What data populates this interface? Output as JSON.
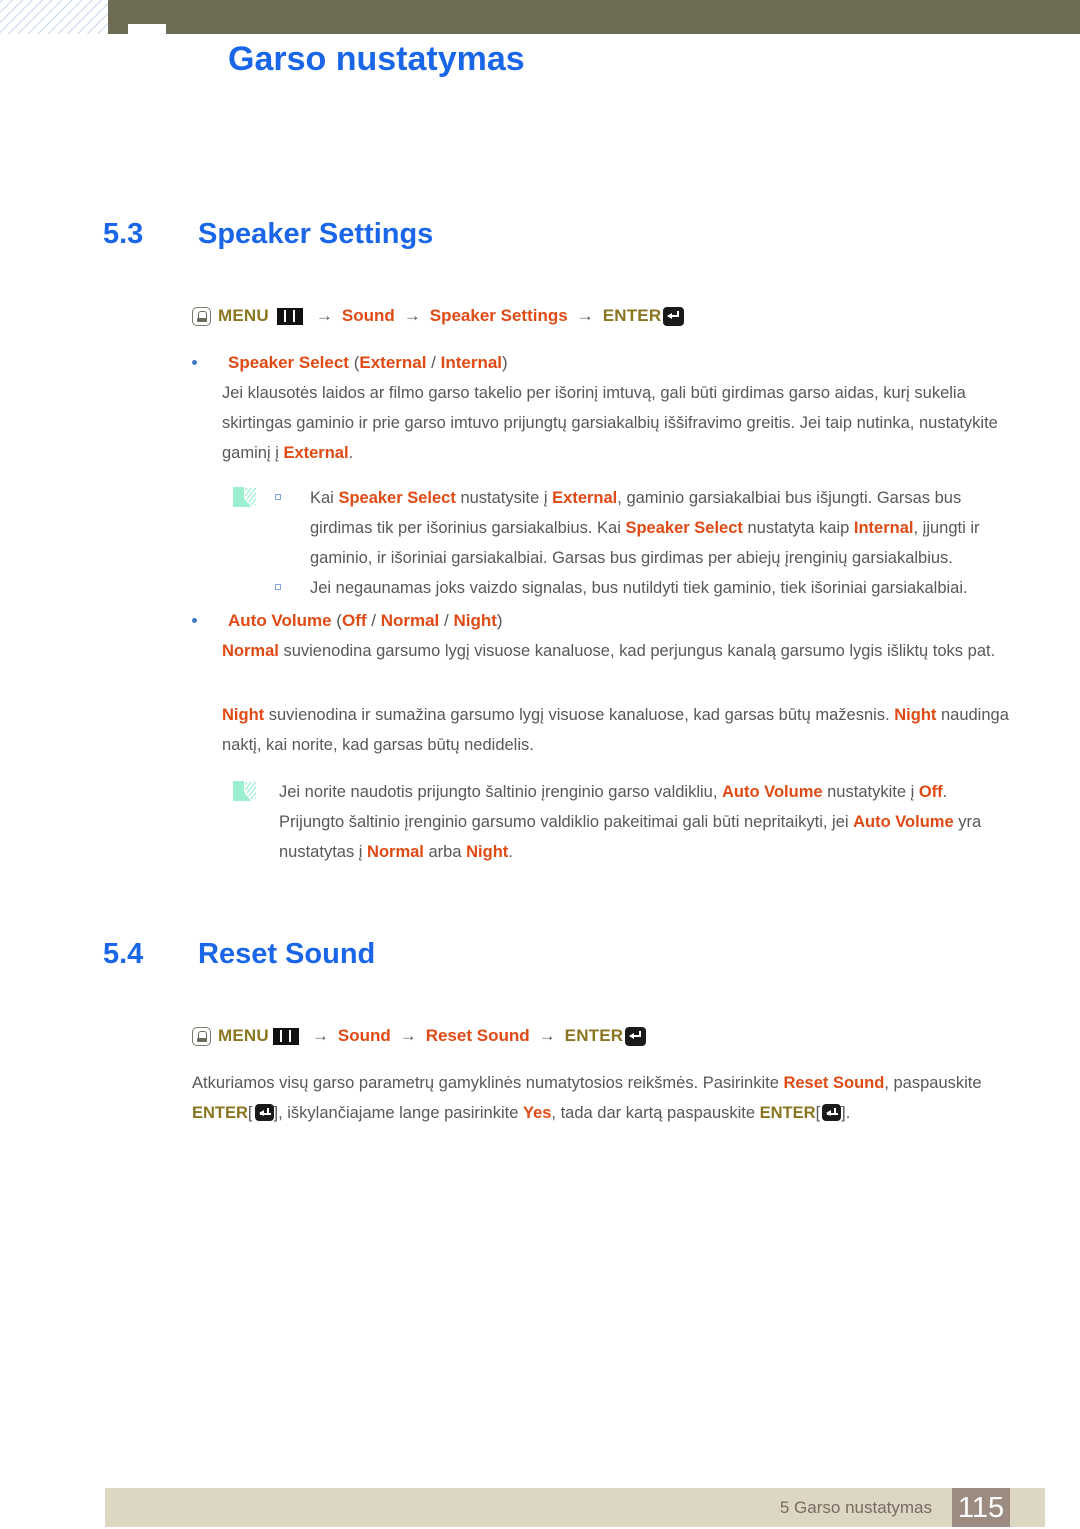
{
  "header": {
    "title": "Garso nustatymas"
  },
  "sections": [
    {
      "number": "5.3",
      "title": "Speaker Settings",
      "menu_path": {
        "press_icon": "hand-press-icon",
        "menu_label": "MENU",
        "bars_icon": "menu-bars-icon",
        "arrow": "→",
        "step1": "Sound",
        "step2": "Speaker Settings",
        "enter_label": "ENTER",
        "enter_icon": "enter-key-icon"
      },
      "bullets": [
        {
          "label": "Speaker Select",
          "open_paren": " (",
          "opt1": "External",
          "sep": " / ",
          "opt2": "Internal",
          "close_paren": ")",
          "paragraph_pre": "Jei klausotės laidos ar filmo garso takelio per išorinį imtuvą, gali būti girdimas garso aidas, kurį sukelia skirtingas gaminio ir prie garso imtuvo prijungtų garsiakalbių iššifravimo greitis. Jei taip nutinka, nustatykite gaminį į ",
          "paragraph_hl": "External",
          "paragraph_post": "."
        }
      ]
    },
    {
      "number": "5.4",
      "title": "Reset Sound",
      "menu_path": {
        "press_icon": "hand-press-icon",
        "menu_label": "MENU",
        "bars_icon": "menu-bars-icon",
        "arrow": "→",
        "step1": "Sound",
        "step2": "Reset Sound",
        "enter_label": "ENTER",
        "enter_icon": "enter-key-icon"
      }
    }
  ],
  "note1": {
    "icon": "note-pencil-icon",
    "items": [
      {
        "p1": "Kai ",
        "h1": "Speaker Select",
        "p2": " nustatysite į ",
        "h2": "External",
        "p3": ", gaminio garsiakalbiai bus išjungti. Garsas bus girdimas tik per išorinius garsiakalbius. Kai ",
        "h3": "Speaker Select",
        "p4": " nustatyta kaip ",
        "h4": "Internal",
        "p5": ", įjungti ir gaminio, ir išoriniai garsiakalbiai. Garsas bus girdimas per abiejų įrenginių garsiakalbius."
      },
      {
        "p1": "Jei negaunamas joks vaizdo signalas, bus nutildyti tiek gaminio, tiek išoriniai garsiakalbiai."
      }
    ]
  },
  "auto_volume": {
    "label": "Auto Volume",
    "open_paren": " (",
    "opt1": "Off",
    "sep1": " / ",
    "opt2": "Normal",
    "sep2": " / ",
    "opt3": "Night",
    "close_paren": ")",
    "para_normal_hl": "Normal",
    "para_normal": " suvienodina garsumo lygį visuose kanaluose, kad perjungus kanalą garsumo lygis išliktų toks pat.",
    "para_night_hl1": "Night",
    "para_night_mid": " suvienodina ir sumažina garsumo lygį visuose kanaluose, kad garsas būtų mažesnis. ",
    "para_night_hl2": "Night",
    "para_night_end": " naudinga naktį, kai norite, kad garsas būtų nedidelis."
  },
  "note2": {
    "icon": "note-pencil-icon",
    "p1": "Jei norite naudotis prijungto šaltinio įrenginio garso valdikliu, ",
    "h1": "Auto Volume",
    "p2": " nustatykite į ",
    "h2": "Off",
    "p3": ". Prijungto šaltinio įrenginio garsumo valdiklio pakeitimai gali būti nepritaikyti, jei ",
    "h3": "Auto Volume",
    "p4": " yra nustatytas į ",
    "h4": "Normal",
    "p5": " arba ",
    "h5": "Night",
    "p6": "."
  },
  "reset_para": {
    "p1": "Atkuriamos visų garso parametrų gamyklinės numatytosios reikšmės. Pasirinkite ",
    "h1": "Reset Sound",
    "p2": ", paspauskite ",
    "enter1": "ENTER",
    "br1": "[",
    "br2": "], iškylančiajame lange pasirinkite ",
    "h2": "Yes",
    "p3": ", tada dar kartą paspauskite ",
    "enter2": "ENTER",
    "br3": "[",
    "br4": "]."
  },
  "footer": {
    "text": "5 Garso nustatymas",
    "page": "115"
  },
  "colors": {
    "heading_blue": "#1a66e8",
    "highlight_orange": "#e04a14",
    "olive": "#8a7520",
    "body_gray": "#58585a",
    "header_bar": "#6f6c56",
    "footer_bar": "#dcd6c2",
    "page_box": "#9c8b80",
    "note_icon": "#9af0cf"
  }
}
